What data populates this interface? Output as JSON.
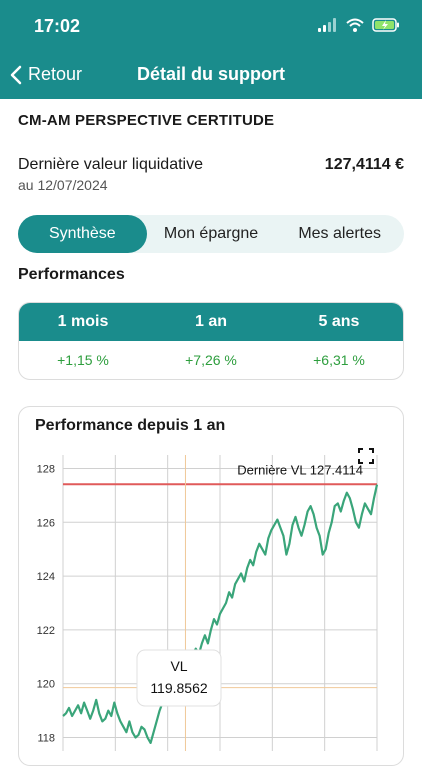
{
  "status": {
    "time": "17:02"
  },
  "nav": {
    "back_label": "Retour",
    "title": "Détail du support"
  },
  "fund": {
    "name": "CM-AM PERSPECTIVE CERTITUDE",
    "vl_label": "Dernière valeur liquidative",
    "vl_date": "au 12/07/2024",
    "vl_value": "127,4114 €"
  },
  "tabs": [
    {
      "label": "Synthèse",
      "active": true
    },
    {
      "label": "Mon épargne",
      "active": false
    },
    {
      "label": "Mes alertes",
      "active": false
    }
  ],
  "performances": {
    "title": "Performances",
    "headers": [
      "1 mois",
      "1 an",
      "5 ans"
    ],
    "values": [
      "+1,15 %",
      "+7,26 %",
      "+6,31 %"
    ]
  },
  "colors": {
    "brand": "#1a8c8c",
    "positive": "#2e9e3e",
    "line": "#3aa57a",
    "last_vl": "#e05a5a",
    "crosshair": "#f0c898"
  },
  "chart_data": {
    "type": "line",
    "title": "Performance depuis 1 an",
    "ylim": [
      117.5,
      128.5
    ],
    "yticks": [
      "118",
      "120",
      "122",
      "124",
      "126",
      "128"
    ],
    "grid": true,
    "last_vl_label": "Dernière VL 127.4114",
    "last_vl": 127.4114,
    "tooltip": {
      "label": "VL",
      "value": "119.8562",
      "y": 119.8562,
      "xi": 0.39
    },
    "series": [
      {
        "values": [
          118.8,
          118.9,
          119.1,
          118.8,
          119.0,
          119.2,
          118.9,
          119.3,
          119.0,
          118.7,
          119.0,
          119.4,
          118.9,
          118.6,
          118.7,
          119.0,
          118.8,
          119.3,
          118.9,
          118.6,
          118.4,
          118.2,
          118.6,
          118.2,
          118.0,
          118.1,
          118.4,
          118.3,
          118.0,
          117.8,
          118.2,
          118.6,
          119.0,
          119.3,
          119.6,
          119.86,
          120.2,
          120.5,
          120.4,
          120.7,
          120.8,
          120.9,
          120.6,
          121.1,
          121.3,
          121.1,
          121.5,
          121.8,
          121.5,
          122.0,
          122.4,
          122.2,
          122.6,
          122.8,
          123.0,
          123.4,
          123.2,
          123.7,
          123.9,
          124.1,
          123.8,
          124.3,
          124.6,
          124.4,
          124.9,
          125.2,
          125.0,
          124.8,
          125.4,
          125.7,
          125.9,
          126.1,
          125.8,
          125.5,
          124.8,
          125.2,
          125.9,
          126.2,
          125.8,
          125.5,
          125.9,
          126.4,
          126.6,
          126.3,
          125.8,
          125.5,
          124.8,
          125.0,
          125.6,
          126.0,
          126.6,
          126.7,
          126.4,
          126.8,
          127.1,
          126.9,
          126.5,
          126.0,
          125.8,
          126.3,
          126.7,
          126.5,
          126.3,
          126.9,
          127.4
        ]
      }
    ]
  }
}
